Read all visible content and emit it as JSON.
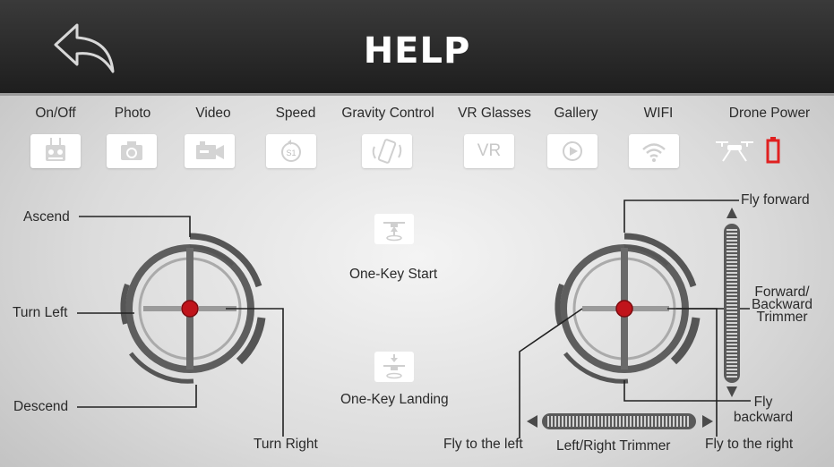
{
  "header": {
    "title": "HELP"
  },
  "toolbar": {
    "on_off": "On/Off",
    "photo": "Photo",
    "video": "Video",
    "speed": "Speed",
    "gravity": "Gravity Control",
    "vr": "VR Glasses",
    "vr_icon_text": "VR",
    "gallery": "Gallery",
    "wifi": "WIFI",
    "drone_power": "Drone Power"
  },
  "left_stick": {
    "ascend": "Ascend",
    "turn_left": "Turn Left",
    "descend": "Descend",
    "turn_right": "Turn Right"
  },
  "center": {
    "start": "One-Key Start",
    "landing": "One-Key Landing"
  },
  "right_stick": {
    "fly_forward": "Fly forward",
    "trimmer_fb_line1": "Forward/",
    "trimmer_fb_line2": "Backward",
    "trimmer_fb_line3": "Trimmer",
    "fly_backward_line1": "Fly",
    "fly_backward_line2": "backward",
    "fly_left": "Fly to the left",
    "trimmer_lr": "Left/Right Trimmer",
    "fly_right": "Fly to the right"
  },
  "colors": {
    "header_bg": "#2a2a2a",
    "joystick_red": "#c0141b",
    "battery_red": "#e02020",
    "ring_gray": "#5a5a5a"
  }
}
